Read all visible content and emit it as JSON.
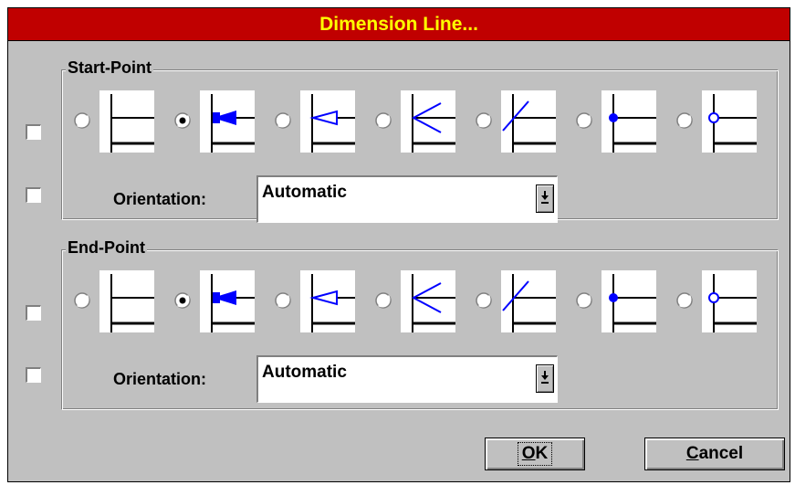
{
  "dialog": {
    "title": "Dimension Line..."
  },
  "start_point": {
    "label": "Start-Point",
    "selected_style": 2,
    "orientation_label": "Orientation:",
    "orientation_value": "Automatic"
  },
  "end_point": {
    "label": "End-Point",
    "selected_style": 2,
    "orientation_label": "Orientation:",
    "orientation_value": "Automatic"
  },
  "endpoint_styles": [
    {
      "icon": "plain-line-icon"
    },
    {
      "icon": "filled-arrow-icon"
    },
    {
      "icon": "open-triangle-arrow-icon"
    },
    {
      "icon": "open-arrow-icon"
    },
    {
      "icon": "slash-tick-icon"
    },
    {
      "icon": "filled-dot-icon"
    },
    {
      "icon": "open-circle-icon"
    }
  ],
  "buttons": {
    "ok_u": "O",
    "ok_rest": "K",
    "cancel_u": "C",
    "cancel_rest": "ancel"
  },
  "colors": {
    "title_bg": "#c00000",
    "title_fg": "#ffff00",
    "icon_blue": "#0000ff",
    "face": "#c0c0c0"
  }
}
